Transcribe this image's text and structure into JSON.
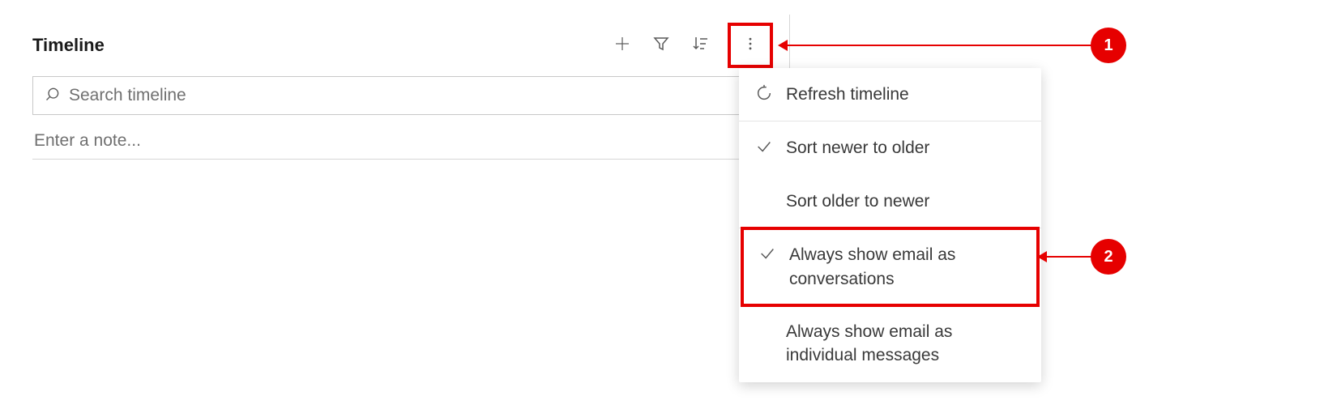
{
  "timeline": {
    "title": "Timeline",
    "search_placeholder": "Search timeline",
    "note_placeholder": "Enter a note..."
  },
  "menu": {
    "items": [
      {
        "label": "Refresh timeline",
        "icon": "refresh-icon",
        "checked": false
      },
      {
        "label": "Sort newer to older",
        "icon": "check-icon",
        "checked": true
      },
      {
        "label": "Sort older to newer",
        "icon": "",
        "checked": false
      },
      {
        "label": "Always show email as conversations",
        "icon": "check-icon",
        "checked": true
      },
      {
        "label": "Always show email as individual messages",
        "icon": "",
        "checked": false
      }
    ]
  },
  "callouts": {
    "c1": "1",
    "c2": "2"
  },
  "colors": {
    "accent": "#e60000"
  }
}
